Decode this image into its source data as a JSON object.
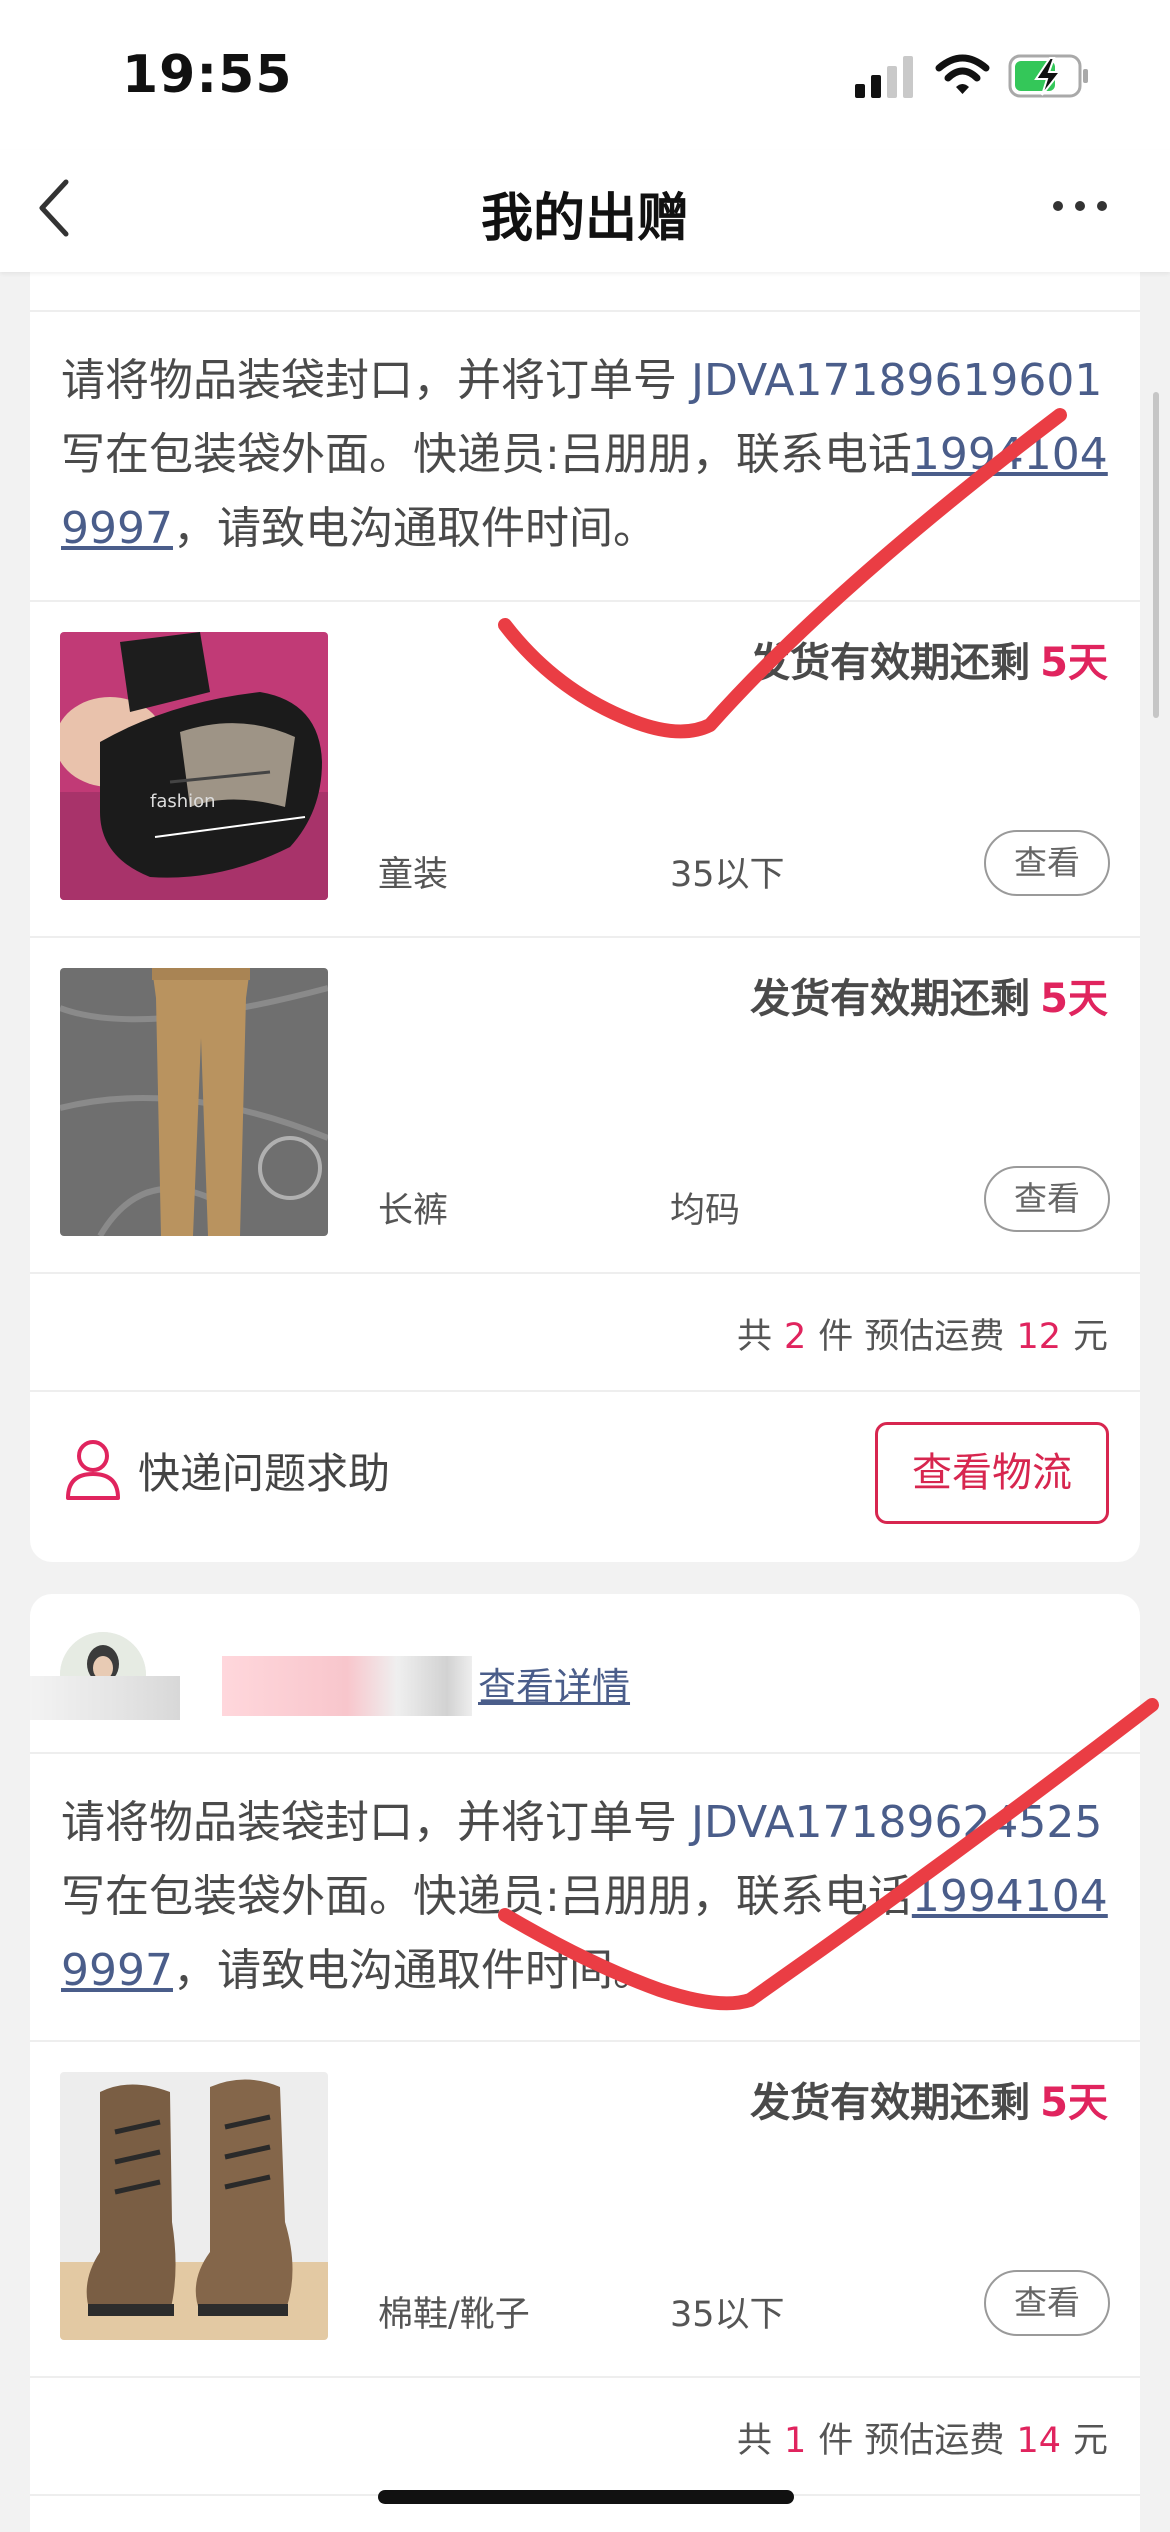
{
  "status_bar": {
    "time": "19:55"
  },
  "nav": {
    "title": "我的出赠"
  },
  "orders": [
    {
      "instruction": {
        "prefix": "请将物品装袋封口，并将订单号",
        "order_no": "JDVA17189619601",
        "middle": "写在包装袋外面。快递员:吕朋朋，联系电话",
        "phone": "19941049997",
        "suffix": "，请致电沟通取件时间。"
      },
      "items": [
        {
          "deadline_label": "发货有效期还剩",
          "deadline_value": "5天",
          "category": "童装",
          "size": "35以下",
          "view_label": "查看"
        },
        {
          "deadline_label": "发货有效期还剩",
          "deadline_value": "5天",
          "category": "长裤",
          "size": "均码",
          "view_label": "查看"
        }
      ],
      "summary": {
        "prefix": "共",
        "count": "2",
        "count_unit": "件 预估运费",
        "fee": "12",
        "fee_unit": "元"
      },
      "help_label": "快递问题求助",
      "logistics_label": "查看物流"
    },
    {
      "receiver": {
        "detail_link": "查看详情"
      },
      "instruction": {
        "prefix": "请将物品装袋封口，并将订单号",
        "order_no": "JDVA17189624525",
        "middle": "写在包装袋外面。快递员:吕朋朋，联系电话",
        "phone": "19941049997",
        "suffix": "，请致电沟通取件时间。"
      },
      "items": [
        {
          "deadline_label": "发货有效期还剩",
          "deadline_value": "5天",
          "category": "棉鞋/靴子",
          "size": "35以下",
          "view_label": "查看"
        }
      ],
      "summary": {
        "prefix": "共",
        "count": "1",
        "count_unit": "件 预估运费",
        "fee": "14",
        "fee_unit": "元"
      }
    }
  ],
  "colors": {
    "accent_red": "#e0245e",
    "button_red": "#d7264f",
    "link_blue": "#4a5d8a",
    "scribble": "#ea3d44"
  },
  "icons": [
    "back-chevron-icon",
    "more-dots-icon",
    "user-outline-icon",
    "signal-icon",
    "wifi-icon",
    "battery-charging-icon"
  ]
}
